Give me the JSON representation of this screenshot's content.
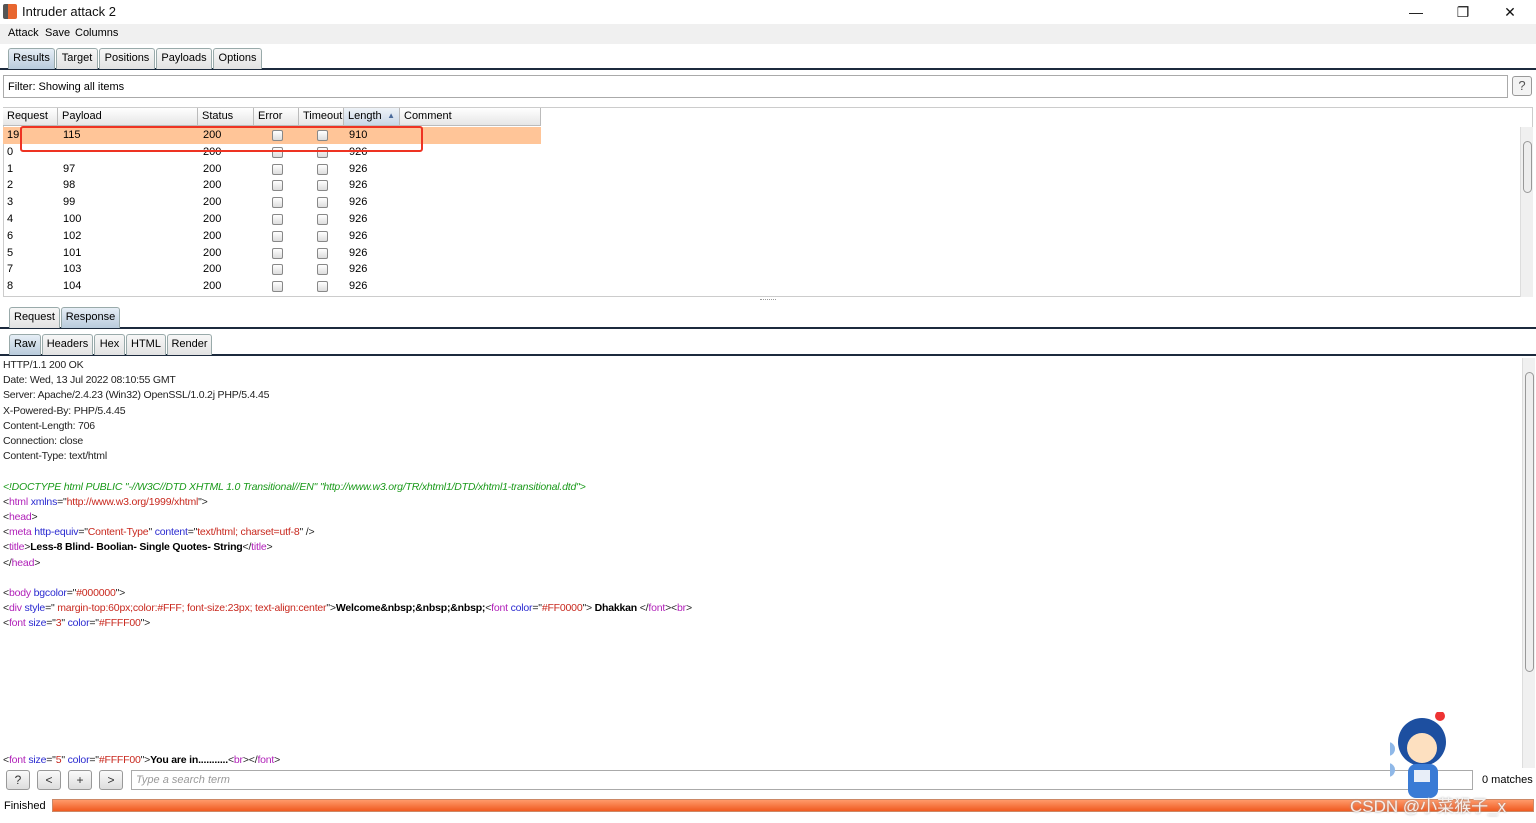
{
  "window": {
    "title": "Intruder attack 2",
    "minimize": "—",
    "restore": "❐",
    "close": "✕"
  },
  "menu": [
    "Attack",
    "Save",
    "Columns"
  ],
  "tabs": [
    "Results",
    "Target",
    "Positions",
    "Payloads",
    "Options"
  ],
  "active_tab": "Results",
  "filter": {
    "text": "Filter: Showing all items",
    "help": "?"
  },
  "table": {
    "columns": [
      "Request",
      "Payload",
      "Status",
      "Error",
      "Timeout",
      "Length",
      "Comment"
    ],
    "sort_indicator": "▲",
    "sorted_column": "Length",
    "rows": [
      {
        "request": "19",
        "payload": "115",
        "status": "200",
        "error": false,
        "timeout": false,
        "length": "910",
        "comment": "",
        "selected": true
      },
      {
        "request": "0",
        "payload": "",
        "status": "200",
        "error": false,
        "timeout": false,
        "length": "926",
        "comment": ""
      },
      {
        "request": "1",
        "payload": "97",
        "status": "200",
        "error": false,
        "timeout": false,
        "length": "926",
        "comment": ""
      },
      {
        "request": "2",
        "payload": "98",
        "status": "200",
        "error": false,
        "timeout": false,
        "length": "926",
        "comment": ""
      },
      {
        "request": "3",
        "payload": "99",
        "status": "200",
        "error": false,
        "timeout": false,
        "length": "926",
        "comment": ""
      },
      {
        "request": "4",
        "payload": "100",
        "status": "200",
        "error": false,
        "timeout": false,
        "length": "926",
        "comment": ""
      },
      {
        "request": "6",
        "payload": "102",
        "status": "200",
        "error": false,
        "timeout": false,
        "length": "926",
        "comment": ""
      },
      {
        "request": "5",
        "payload": "101",
        "status": "200",
        "error": false,
        "timeout": false,
        "length": "926",
        "comment": ""
      },
      {
        "request": "7",
        "payload": "103",
        "status": "200",
        "error": false,
        "timeout": false,
        "length": "926",
        "comment": ""
      },
      {
        "request": "8",
        "payload": "104",
        "status": "200",
        "error": false,
        "timeout": false,
        "length": "926",
        "comment": ""
      }
    ]
  },
  "message_tabs": [
    "Request",
    "Response"
  ],
  "active_message_tab": "Response",
  "view_tabs": [
    "Raw",
    "Headers",
    "Hex",
    "HTML",
    "Render"
  ],
  "active_view_tab": "Raw",
  "response_lines": [
    [
      [
        "plain",
        "HTTP/1.1 200 OK"
      ]
    ],
    [
      [
        "plain",
        "Date: Wed, 13 Jul 2022 08:10:55 GMT"
      ]
    ],
    [
      [
        "plain",
        "Server: Apache/2.4.23 (Win32) OpenSSL/1.0.2j PHP/5.4.45"
      ]
    ],
    [
      [
        "plain",
        "X-Powered-By: PHP/5.4.45"
      ]
    ],
    [
      [
        "plain",
        "Content-Length: 706"
      ]
    ],
    [
      [
        "plain",
        "Connection: close"
      ]
    ],
    [
      [
        "plain",
        "Content-Type: text/html"
      ]
    ],
    [],
    [
      [
        "doctype",
        "<!DOCTYPE html PUBLIC \"-//W3C//DTD XHTML 1.0 Transitional//EN\" \"http://www.w3.org/TR/xhtml1/DTD/xhtml1-transitional.dtd\">"
      ]
    ],
    [
      [
        "plain",
        "<"
      ],
      [
        "tag",
        "html"
      ],
      [
        "attr",
        " xmlns"
      ],
      [
        "plain",
        "=\""
      ],
      [
        "val",
        "http://www.w3.org/1999/xhtml"
      ],
      [
        "plain",
        "\">"
      ]
    ],
    [
      [
        "plain",
        "<"
      ],
      [
        "tag",
        "head"
      ],
      [
        "plain",
        ">"
      ]
    ],
    [
      [
        "plain",
        "<"
      ],
      [
        "tag",
        "meta"
      ],
      [
        "attr",
        " http-equiv"
      ],
      [
        "plain",
        "=\""
      ],
      [
        "val",
        "Content-Type"
      ],
      [
        "plain",
        "\" "
      ],
      [
        "attr",
        "content"
      ],
      [
        "plain",
        "=\""
      ],
      [
        "val",
        "text/html; charset=utf-8"
      ],
      [
        "plain",
        "\" />"
      ]
    ],
    [
      [
        "plain",
        "<"
      ],
      [
        "tag",
        "title"
      ],
      [
        "plain",
        ">"
      ],
      [
        "text",
        "Less-8 Blind- Boolian- Single Quotes- String"
      ],
      [
        "plain",
        "</"
      ],
      [
        "tag",
        "title"
      ],
      [
        "plain",
        ">"
      ]
    ],
    [
      [
        "plain",
        "</"
      ],
      [
        "tag",
        "head"
      ],
      [
        "plain",
        ">"
      ]
    ],
    [],
    [
      [
        "plain",
        "<"
      ],
      [
        "tag",
        "body"
      ],
      [
        "attr",
        " bgcolor"
      ],
      [
        "plain",
        "=\""
      ],
      [
        "val",
        "#000000"
      ],
      [
        "plain",
        "\">"
      ]
    ],
    [
      [
        "plain",
        "<"
      ],
      [
        "tag",
        "div"
      ],
      [
        "attr",
        " style"
      ],
      [
        "plain",
        "=\""
      ],
      [
        "val",
        " margin-top:60px;color:#FFF; font-size:23px; text-align:center"
      ],
      [
        "plain",
        "\">"
      ],
      [
        "text",
        "Welcome&nbsp;&nbsp;&nbsp;"
      ],
      [
        "plain",
        "<"
      ],
      [
        "tag",
        "font"
      ],
      [
        "attr",
        " color"
      ],
      [
        "plain",
        "=\""
      ],
      [
        "val",
        "#FF0000"
      ],
      [
        "plain",
        "\">"
      ],
      [
        "text",
        " Dhakkan "
      ],
      [
        "plain",
        "</"
      ],
      [
        "tag",
        "font"
      ],
      [
        "plain",
        "><"
      ],
      [
        "tag",
        "br"
      ],
      [
        "plain",
        ">"
      ]
    ],
    [
      [
        "plain",
        "<"
      ],
      [
        "tag",
        "font"
      ],
      [
        "attr",
        " size"
      ],
      [
        "plain",
        "=\""
      ],
      [
        "val",
        "3"
      ],
      [
        "plain",
        "\" "
      ],
      [
        "attr",
        "color"
      ],
      [
        "plain",
        "=\""
      ],
      [
        "val",
        "#FFFF00"
      ],
      [
        "plain",
        "\">"
      ]
    ]
  ],
  "response_last_line": [
    [
      "plain",
      "<"
    ],
    [
      "tag",
      "font"
    ],
    [
      "attr",
      " size"
    ],
    [
      "plain",
      "=\""
    ],
    [
      "val",
      "5"
    ],
    [
      "plain",
      "\" "
    ],
    [
      "attr",
      "color"
    ],
    [
      "plain",
      "=\""
    ],
    [
      "val",
      "#FFFF00"
    ],
    [
      "plain",
      "\">"
    ],
    [
      "text",
      "You are in..........."
    ],
    [
      "plain",
      "<"
    ],
    [
      "tag",
      "br"
    ],
    [
      "plain",
      "></"
    ],
    [
      "tag",
      "font"
    ],
    [
      "plain",
      ">"
    ]
  ],
  "search": {
    "help": "?",
    "prev": "<",
    "add": "+",
    "next": ">",
    "placeholder": "Type a search term",
    "matches": "0 matches"
  },
  "status": {
    "text": "Finished",
    "progress": 1.0
  },
  "watermark": "CSDN @小菜猴子_x"
}
